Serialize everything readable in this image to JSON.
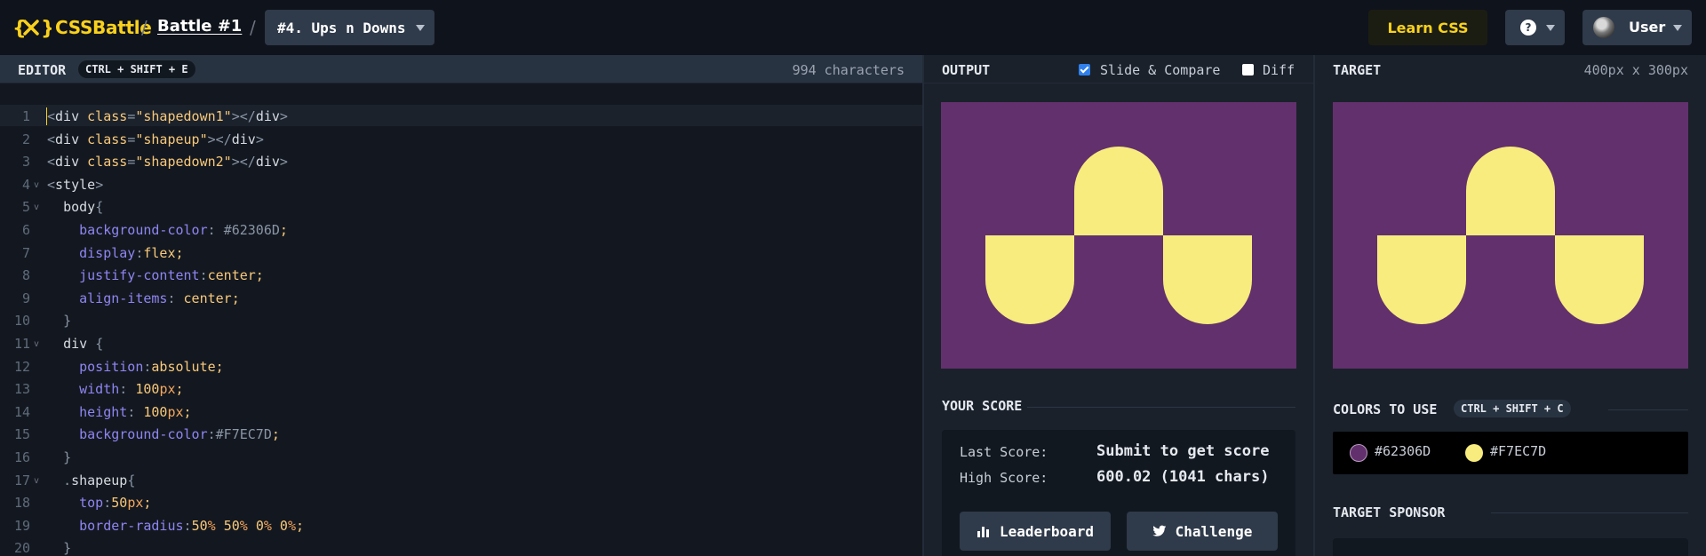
{
  "topbar": {
    "logo_text": "CSSBattle",
    "separator": "/",
    "battle_link": "Battle #1",
    "level_select": "#4. Ups n Downs",
    "learn_css": "Learn CSS",
    "help_label": "?",
    "user_label": "User"
  },
  "editor": {
    "title": "EDITOR",
    "shortcut": "CTRL + SHIFT + E",
    "char_count": "994 characters",
    "lines": [
      {
        "n": "1",
        "fold": "",
        "html": "<span class='t-punct'>&lt;</span><span class='t-tag'>div</span> <span class='t-attr'>class</span><span class='t-punct'>=</span><span class='t-str'>\"shapedown1\"</span><span class='t-punct'>&gt;&lt;/</span><span class='t-tag'>div</span><span class='t-punct'>&gt;</span>"
      },
      {
        "n": "2",
        "fold": "",
        "html": "<span class='t-punct'>&lt;</span><span class='t-tag'>div</span> <span class='t-attr'>class</span><span class='t-punct'>=</span><span class='t-str'>\"shapeup\"</span><span class='t-punct'>&gt;&lt;/</span><span class='t-tag'>div</span><span class='t-punct'>&gt;</span>"
      },
      {
        "n": "3",
        "fold": "",
        "html": "<span class='t-punct'>&lt;</span><span class='t-tag'>div</span> <span class='t-attr'>class</span><span class='t-punct'>=</span><span class='t-str'>\"shapedown2\"</span><span class='t-punct'>&gt;&lt;/</span><span class='t-tag'>div</span><span class='t-punct'>&gt;</span>"
      },
      {
        "n": "4",
        "fold": "v",
        "html": "<span class='t-punct'>&lt;</span><span class='t-tag'>style</span><span class='t-punct'>&gt;</span>"
      },
      {
        "n": "5",
        "fold": "v",
        "html": "  <span class='t-sel'>body</span><span class='t-punct'>{</span>"
      },
      {
        "n": "6",
        "fold": "",
        "html": "    <span class='t-prop'>background-color</span><span class='t-punct'>:</span> <span class='t-hash'>#62306D</span><span class='t-val'>;</span>"
      },
      {
        "n": "7",
        "fold": "",
        "html": "    <span class='t-prop'>display</span><span class='t-punct'>:</span><span class='t-val'>flex;</span>"
      },
      {
        "n": "8",
        "fold": "",
        "html": "    <span class='t-prop'>justify-content</span><span class='t-punct'>:</span><span class='t-val'>center;</span>"
      },
      {
        "n": "9",
        "fold": "",
        "html": "    <span class='t-prop'>align-items</span><span class='t-punct'>:</span> <span class='t-val'>center;</span>"
      },
      {
        "n": "10",
        "fold": "",
        "html": "  <span class='t-punct'>}</span>"
      },
      {
        "n": "11",
        "fold": "v",
        "html": "  <span class='t-sel'>div</span> <span class='t-punct'>{</span>"
      },
      {
        "n": "12",
        "fold": "",
        "html": "    <span class='t-prop'>position</span><span class='t-punct'>:</span><span class='t-val'>absolute;</span>"
      },
      {
        "n": "13",
        "fold": "",
        "html": "    <span class='t-prop'>width</span><span class='t-punct'>:</span> <span class='t-num'>100</span><span class='t-unit'>px</span><span class='t-val'>;</span>"
      },
      {
        "n": "14",
        "fold": "",
        "html": "    <span class='t-prop'>height</span><span class='t-punct'>:</span> <span class='t-num'>100</span><span class='t-unit'>px</span><span class='t-val'>;</span>"
      },
      {
        "n": "15",
        "fold": "",
        "html": "    <span class='t-prop'>background-color</span><span class='t-punct'>:</span><span class='t-hash'>#F7EC7D</span><span class='t-val'>;</span>"
      },
      {
        "n": "16",
        "fold": "",
        "html": "  <span class='t-punct'>}</span>"
      },
      {
        "n": "17",
        "fold": "v",
        "html": "  <span class='t-punct'>.</span><span class='t-sel'>shapeup</span><span class='t-punct'>{</span>"
      },
      {
        "n": "18",
        "fold": "",
        "html": "    <span class='t-prop'>top</span><span class='t-punct'>:</span><span class='t-num'>50</span><span class='t-unit'>px</span><span class='t-val'>;</span>"
      },
      {
        "n": "19",
        "fold": "",
        "html": "    <span class='t-prop'>border-radius</span><span class='t-punct'>:</span><span class='t-num'>50</span><span class='t-unit'>%</span> <span class='t-num'>50</span><span class='t-unit'>%</span> <span class='t-num'>0</span><span class='t-unit'>%</span> <span class='t-num'>0</span><span class='t-unit'>%</span><span class='t-val'>;</span>"
      },
      {
        "n": "20",
        "fold": "",
        "html": "  <span class='t-punct'>}</span>"
      }
    ]
  },
  "output": {
    "title": "OUTPUT",
    "slide_compare_label": "Slide & Compare",
    "slide_compare_checked": true,
    "diff_label": "Diff",
    "diff_checked": false
  },
  "score": {
    "title": "YOUR SCORE",
    "last_label": "Last Score:",
    "last_value": "Submit to get score",
    "high_label": "High Score:",
    "high_value": "600.02 (1041 chars)",
    "leaderboard_button": "Leaderboard",
    "challenge_button": "Challenge"
  },
  "target": {
    "title": "TARGET",
    "size": "400px x 300px",
    "colors_title": "COLORS TO USE",
    "colors_shortcut": "CTRL + SHIFT + C",
    "colors": [
      {
        "hex": "#62306D",
        "label": "#62306D"
      },
      {
        "hex": "#F7EC7D",
        "label": "#F7EC7D"
      }
    ],
    "sponsor_title": "TARGET SPONSOR"
  },
  "theme": {
    "brand_yellow": "#F9D11C",
    "canvas_bg": "#62306D",
    "shape_color": "#F7EC7D"
  }
}
